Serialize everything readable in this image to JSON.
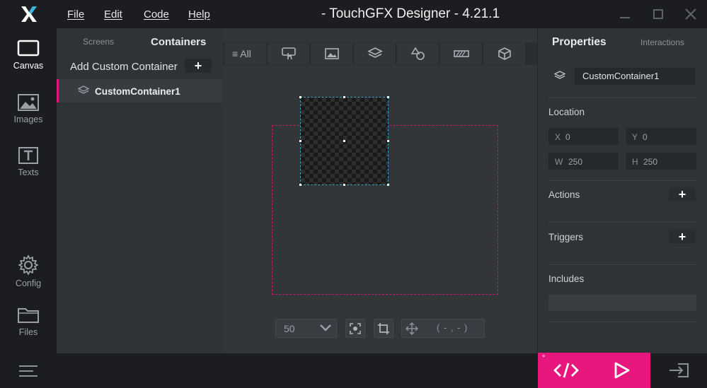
{
  "titlebar": {
    "title": "- TouchGFX Designer - 4.21.1",
    "menu": [
      {
        "label": "File"
      },
      {
        "label": "Edit"
      },
      {
        "label": "Code"
      },
      {
        "label": "Help"
      }
    ],
    "logo_icon": "touchgfx-x-logo",
    "window_controls": [
      "minimize-icon",
      "maximize-icon",
      "close-icon"
    ]
  },
  "leftnav": {
    "items": [
      {
        "label": "Canvas",
        "icon": "canvas-icon",
        "active": true
      },
      {
        "label": "Images",
        "icon": "image-icon"
      },
      {
        "label": "Texts",
        "icon": "text-icon"
      },
      {
        "label": "Config",
        "icon": "gear-icon"
      },
      {
        "label": "Files",
        "icon": "folder-icon"
      }
    ]
  },
  "containers_panel": {
    "tabs": [
      {
        "label": "Screens"
      },
      {
        "label": "Containers",
        "active": true
      }
    ],
    "add_label": "Add Custom Container",
    "add_button": "+",
    "tree": [
      {
        "label": "CustomContainer1",
        "icon": "layers-icon",
        "selected": true
      }
    ]
  },
  "canvas": {
    "toolbar": {
      "all_label": "All",
      "filters": [
        "touch-icon",
        "image-icon",
        "layers-icon",
        "shapes-icon",
        "progress-icon",
        "3d-cube-icon"
      ]
    },
    "zoom": "50",
    "coordinates": "( - , - )"
  },
  "properties_panel": {
    "tabs": [
      {
        "label": "Properties",
        "active": true
      },
      {
        "label": "Interactions"
      }
    ],
    "name": "CustomContainer1",
    "location_label": "Location",
    "location": {
      "x_key": "X",
      "x": "0",
      "y_key": "Y",
      "y": "0",
      "w_key": "W",
      "w": "250",
      "h_key": "H",
      "h": "250"
    },
    "actions_label": "Actions",
    "triggers_label": "Triggers",
    "includes_label": "Includes",
    "plus": "+"
  },
  "colors": {
    "accent": "#e7177d",
    "selection": "#39a6c8",
    "background": "#2b2f33"
  }
}
